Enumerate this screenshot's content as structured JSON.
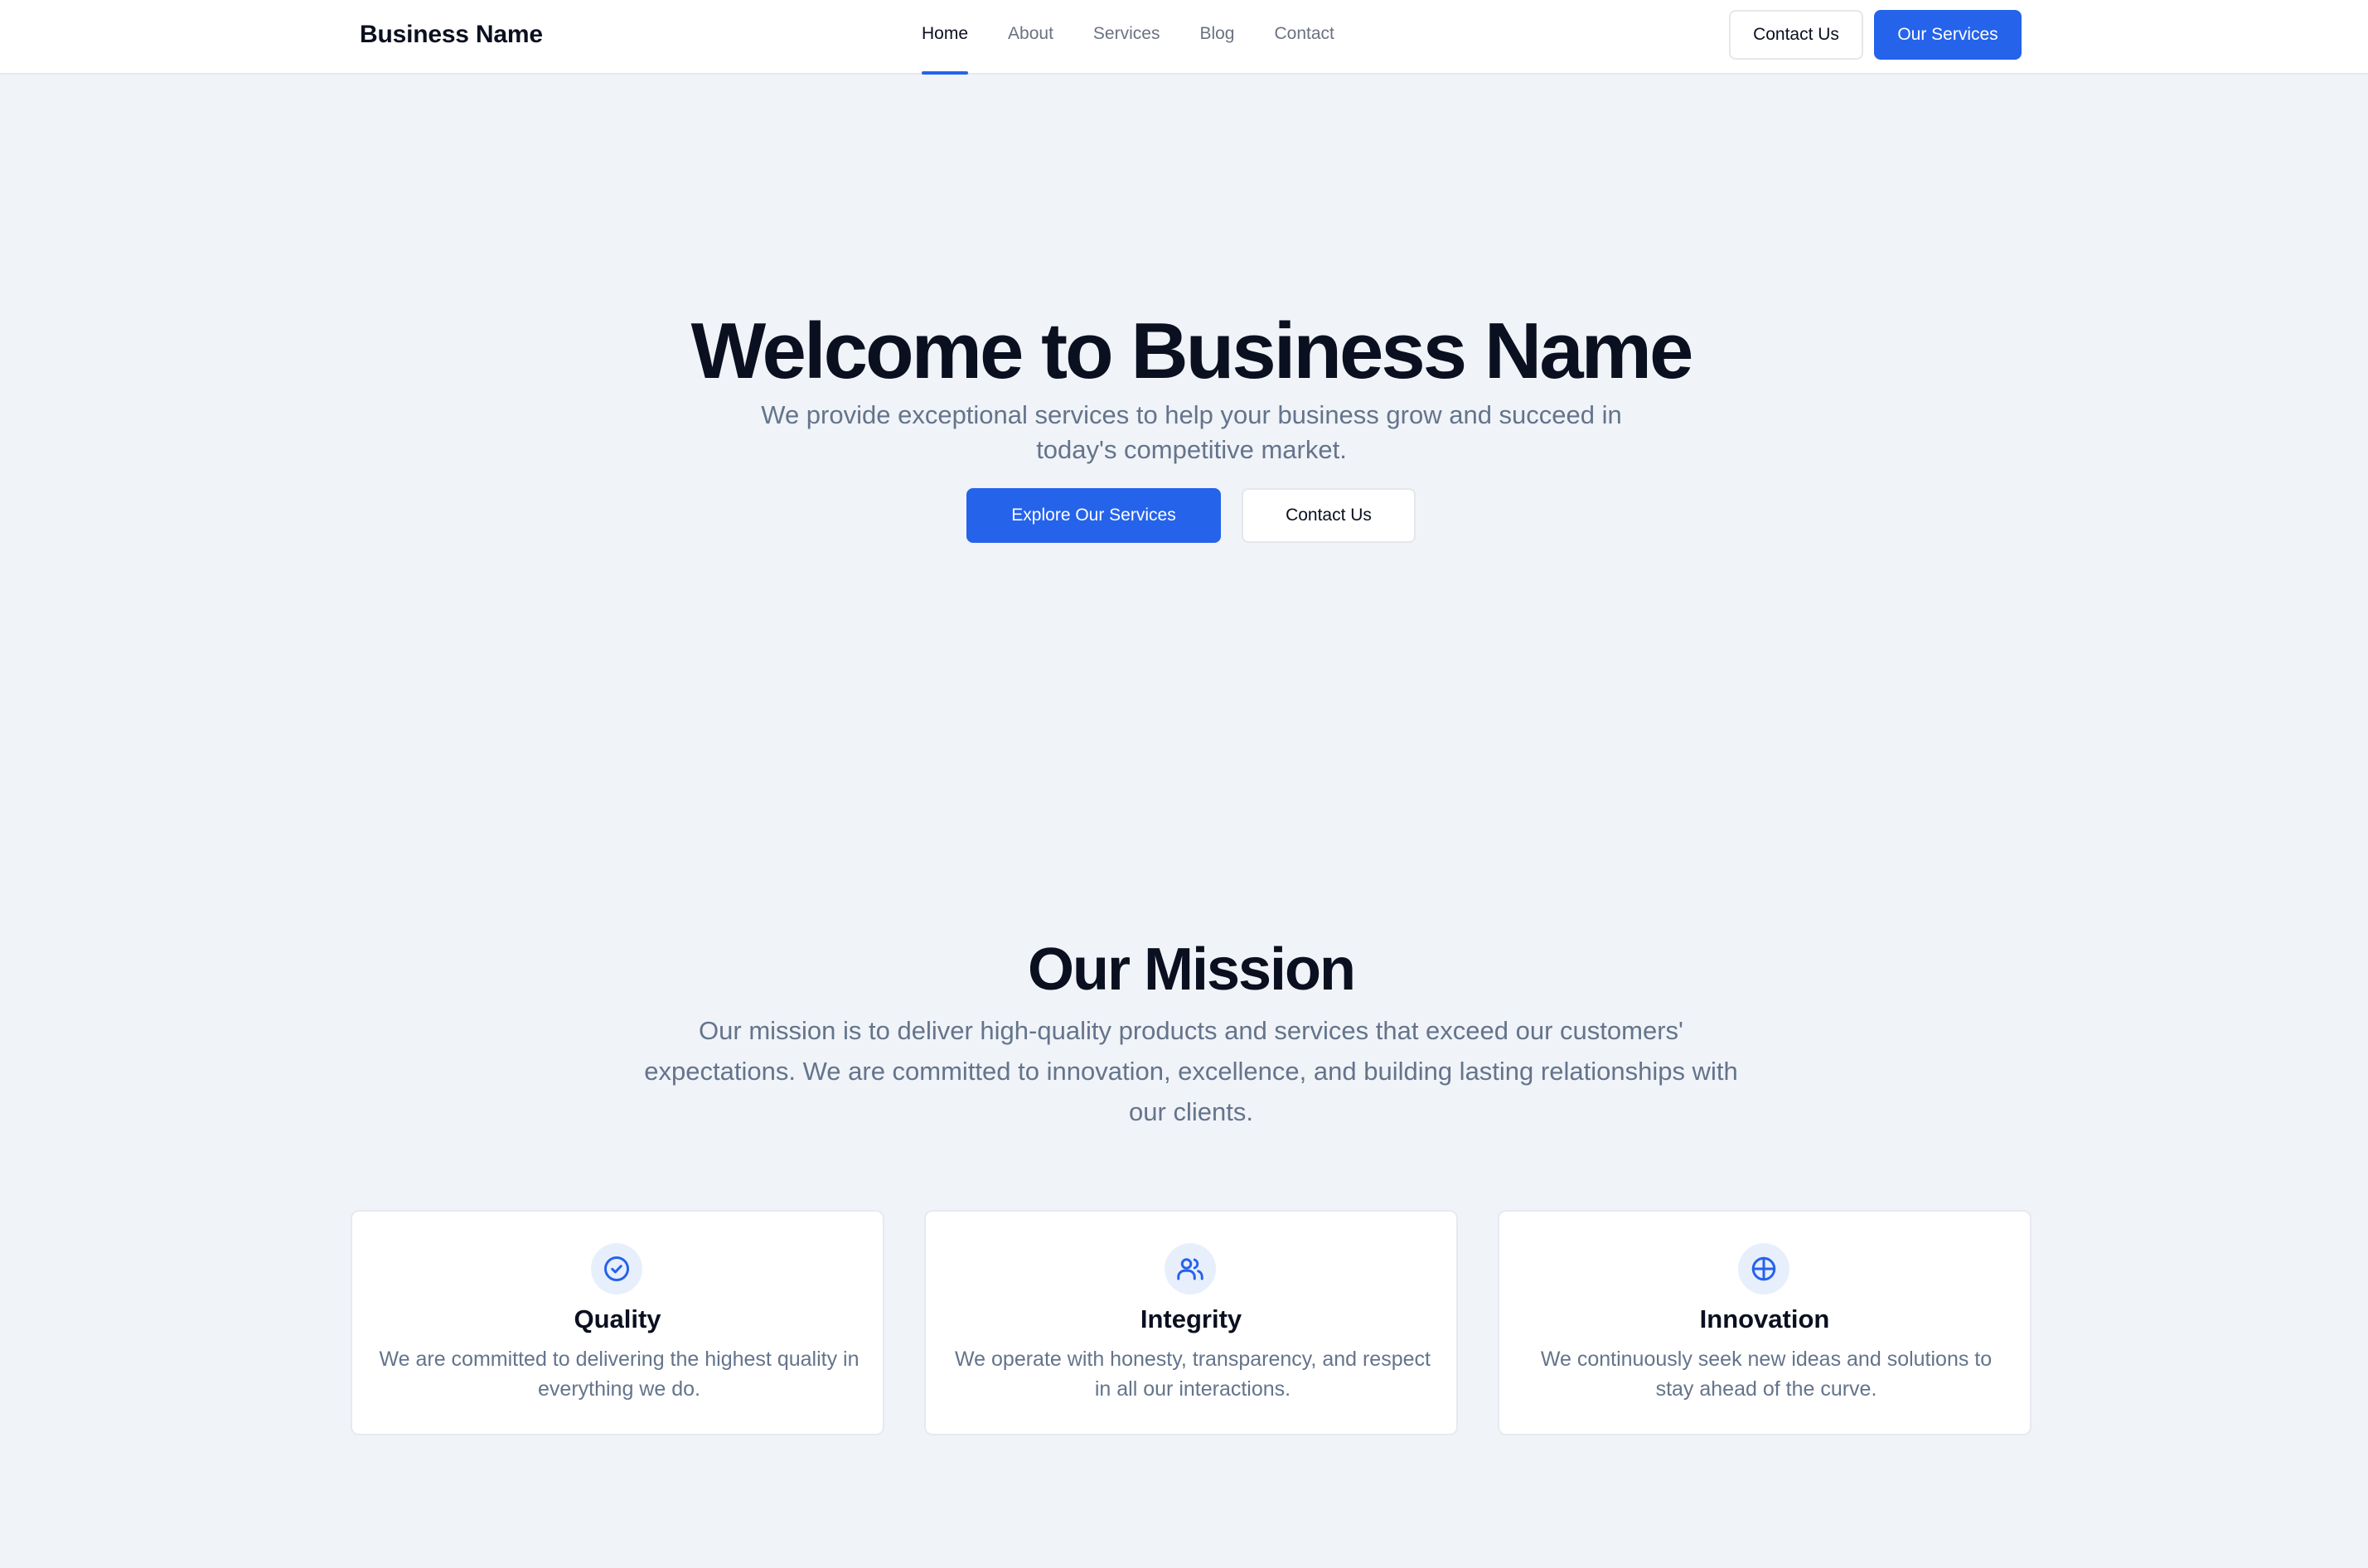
{
  "header": {
    "brand": "Business Name",
    "nav": [
      {
        "label": "Home",
        "active": true
      },
      {
        "label": "About",
        "active": false
      },
      {
        "label": "Services",
        "active": false
      },
      {
        "label": "Blog",
        "active": false
      },
      {
        "label": "Contact",
        "active": false
      }
    ],
    "contact_button": "Contact Us",
    "services_button": "Our Services"
  },
  "hero": {
    "title": "Welcome to Business Name",
    "subtitle": "We provide exceptional services to help your business grow and succeed in today's competitive market.",
    "primary_button": "Explore Our Services",
    "secondary_button": "Contact Us"
  },
  "mission": {
    "title": "Our Mission",
    "text": "Our mission is to deliver high-quality products and services that exceed our customers' expectations. We are committed to innovation, excellence, and building lasting relationships with our clients.",
    "cards": [
      {
        "icon": "check-circle-icon",
        "title": "Quality",
        "description": "We are committed to delivering the highest quality in everything we do."
      },
      {
        "icon": "users-icon",
        "title": "Integrity",
        "description": "We operate with honesty, transparency, and respect in all our interactions."
      },
      {
        "icon": "crosshair-icon",
        "title": "Innovation",
        "description": "We continuously seek new ideas and solutions to stay ahead of the curve."
      }
    ]
  },
  "colors": {
    "accent": "#2563eb",
    "background": "#f0f3f8",
    "text": "#0b1020",
    "muted": "#64748b"
  }
}
